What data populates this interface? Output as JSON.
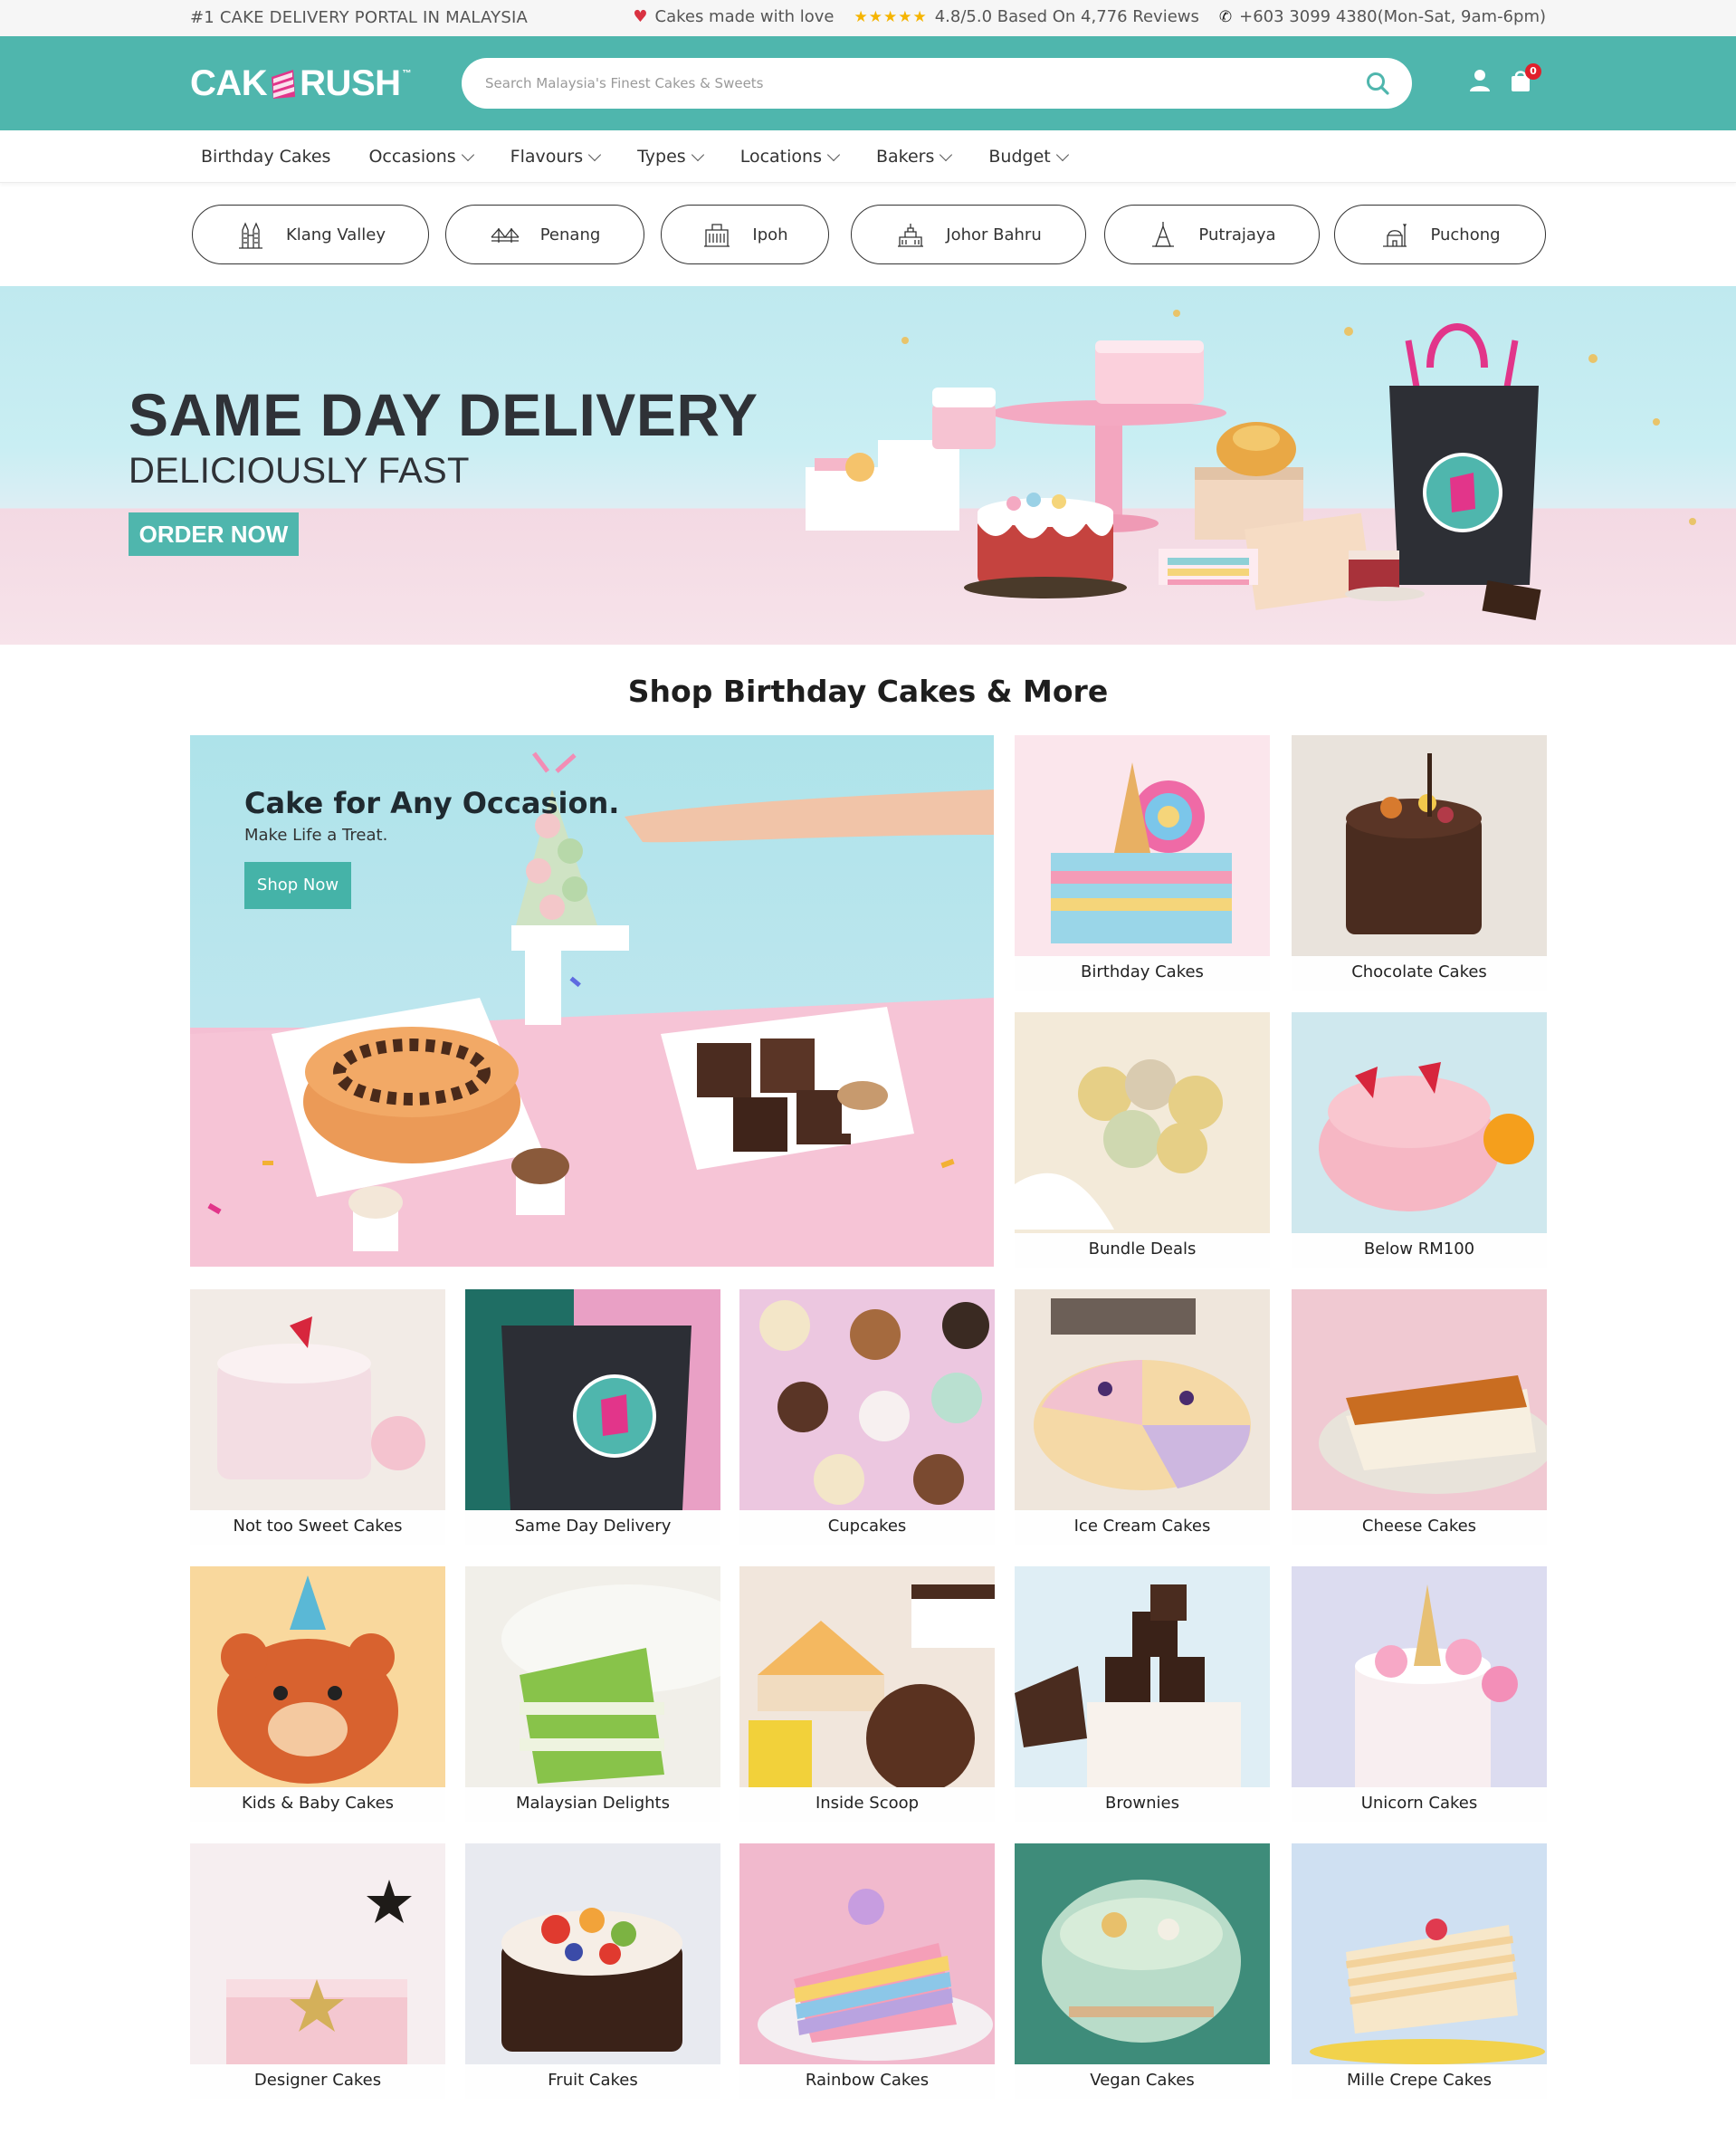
{
  "topbar": {
    "tagline": "#1 CAKE DELIVERY PORTAL IN MALAYSIA",
    "made_with_love": "Cakes made with love",
    "stars": "★★★★★",
    "rating": "4.8/5.0 Based On 4,776 Reviews",
    "phone": "+603 3099 4380(Mon-Sat, 9am-6pm)"
  },
  "header": {
    "logo_left": "CAK",
    "logo_right": "RUSH",
    "logo_tm": "™",
    "search_placeholder": "Search Malaysia's Finest Cakes & Sweets",
    "cart_count": "0"
  },
  "nav": {
    "items": [
      {
        "label": "Birthday Cakes",
        "dropdown": false
      },
      {
        "label": "Occasions",
        "dropdown": true
      },
      {
        "label": "Flavours",
        "dropdown": true
      },
      {
        "label": "Types",
        "dropdown": true
      },
      {
        "label": "Locations",
        "dropdown": true
      },
      {
        "label": "Bakers",
        "dropdown": true
      },
      {
        "label": "Budget",
        "dropdown": true
      }
    ]
  },
  "locations": [
    {
      "label": "Klang Valley",
      "icon": "twin-towers-icon"
    },
    {
      "label": "Penang",
      "icon": "bridge-icon"
    },
    {
      "label": "Ipoh",
      "icon": "railway-station-icon"
    },
    {
      "label": "Johor Bahru",
      "icon": "palace-icon"
    },
    {
      "label": "Putrajaya",
      "icon": "tower-icon"
    },
    {
      "label": "Puchong",
      "icon": "mosque-icon"
    }
  ],
  "hero": {
    "title": "SAME DAY DELIVERY",
    "subtitle": "DELICIOUSLY FAST",
    "cta": "ORDER NOW"
  },
  "section_title": "Shop Birthday Cakes & More",
  "feature": {
    "title": "Cake for Any Occasion.",
    "subtitle": "Make Life a Treat.",
    "cta": "Shop Now"
  },
  "categories": [
    {
      "label": "Birthday Cakes"
    },
    {
      "label": "Chocolate Cakes"
    },
    {
      "label": "Bundle Deals"
    },
    {
      "label": "Below RM100"
    },
    {
      "label": "Not too Sweet Cakes"
    },
    {
      "label": "Same Day Delivery"
    },
    {
      "label": "Cupcakes"
    },
    {
      "label": "Ice Cream Cakes"
    },
    {
      "label": "Cheese Cakes"
    },
    {
      "label": "Kids & Baby Cakes"
    },
    {
      "label": "Malaysian Delights"
    },
    {
      "label": "Inside Scoop"
    },
    {
      "label": "Brownies"
    },
    {
      "label": "Unicorn Cakes"
    },
    {
      "label": "Designer Cakes"
    },
    {
      "label": "Fruit Cakes"
    },
    {
      "label": "Rainbow Cakes"
    },
    {
      "label": "Vegan Cakes"
    },
    {
      "label": "Mille Crepe Cakes"
    }
  ],
  "colors": {
    "brand_teal": "#4fb6ad",
    "badge_red": "#e0202b",
    "heart_red": "#d93241",
    "star_gold": "#f5b400"
  }
}
